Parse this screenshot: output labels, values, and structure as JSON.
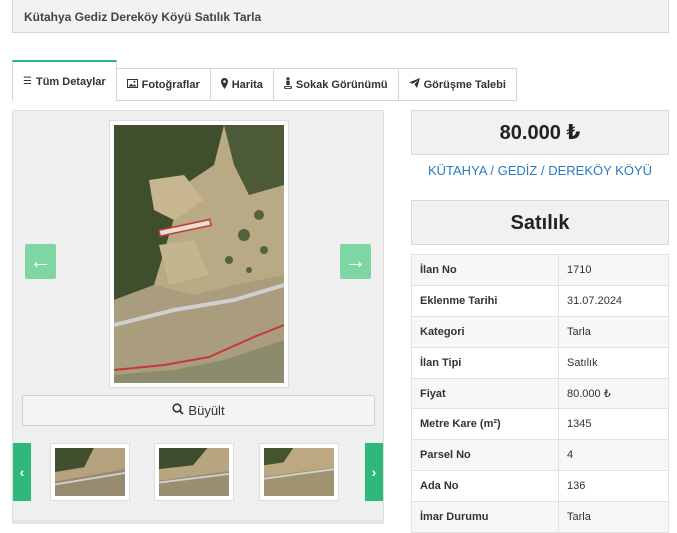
{
  "page": {
    "title": "Kütahya Gediz Dereköy Köyü Satılık Tarla"
  },
  "tabs": [
    {
      "label": "Tüm Detaylar",
      "icon": "list-icon",
      "active": true
    },
    {
      "label": "Fotoğraflar",
      "icon": "image-icon"
    },
    {
      "label": "Harita",
      "icon": "map-marker-icon"
    },
    {
      "label": "Sokak Görünümü",
      "icon": "street-view-icon"
    },
    {
      "label": "Görüşme Talebi",
      "icon": "paper-plane-icon"
    }
  ],
  "gallery": {
    "enlarge_label": "Büyült",
    "prev_symbol": "‹",
    "next_symbol": "›",
    "thumbnails_count": 3
  },
  "listing": {
    "price": "80.000 ₺",
    "location": {
      "city": "KÜTAHYA",
      "district": "GEDİZ",
      "village": "DEREKÖY KÖYÜ",
      "separator": "/"
    },
    "status": "Satılık",
    "details": [
      {
        "key": "İlan No",
        "value": "1710"
      },
      {
        "key": "Eklenme Tarihi",
        "value": "31.07.2024"
      },
      {
        "key": "Kategori",
        "value": "Tarla"
      },
      {
        "key": "İlan Tipi",
        "value": "Satılık"
      },
      {
        "key": "Fiyat",
        "value": "80.000 ₺"
      },
      {
        "key": "Metre Kare (m²)",
        "value": "1345"
      },
      {
        "key": "Parsel No",
        "value": "4"
      },
      {
        "key": "Ada No",
        "value": "136"
      },
      {
        "key": "İmar Durumu",
        "value": "Tarla"
      }
    ]
  },
  "colors": {
    "accent_green": "#2eb87a",
    "arrow_green": "#7fd6a2",
    "link_blue": "#2a7bc0"
  }
}
